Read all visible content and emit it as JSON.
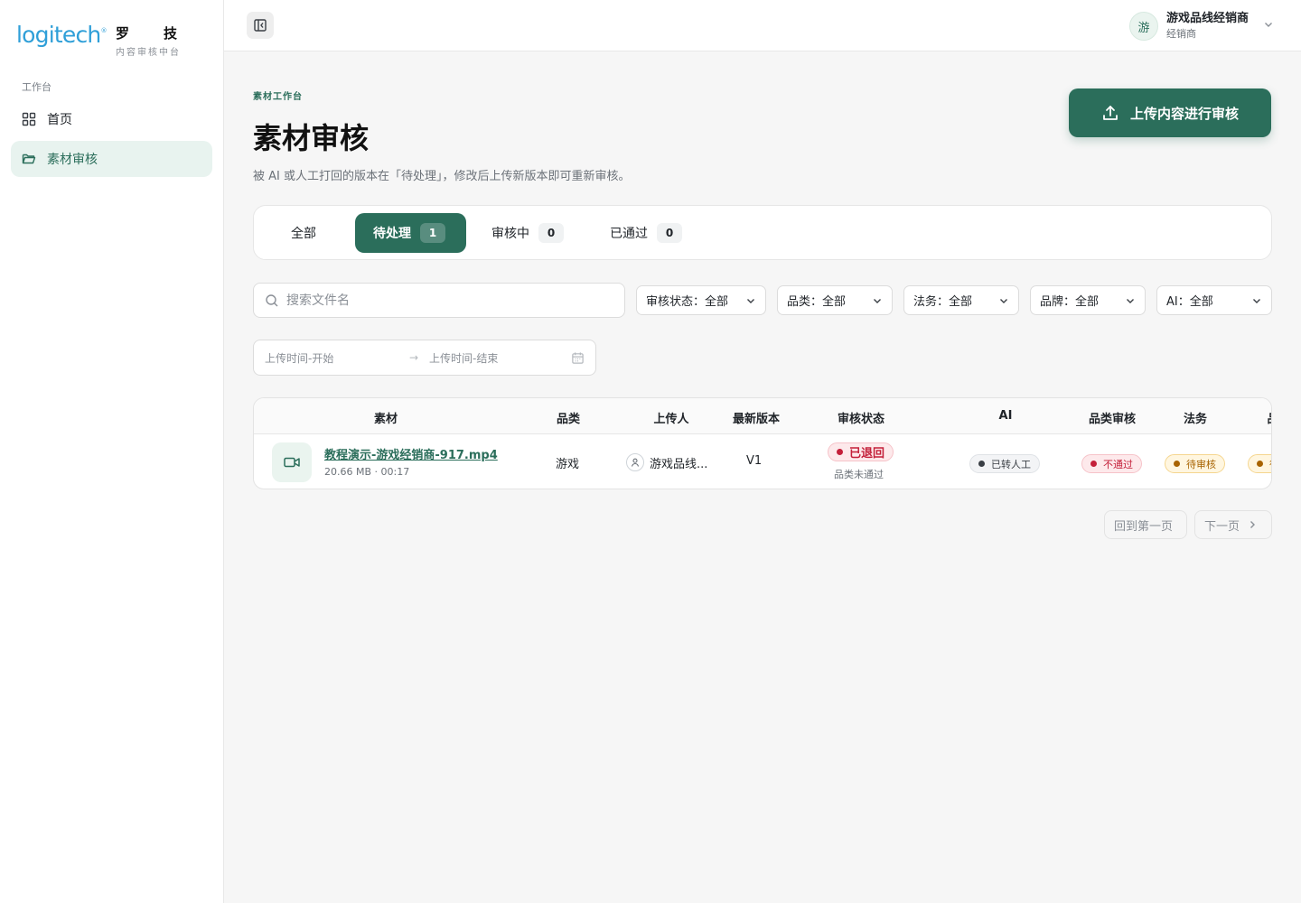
{
  "brand": {
    "logo": "logitech",
    "name_cn": "罗技",
    "subtitle": "内容审核中台"
  },
  "sidebar": {
    "section_label": "工作台",
    "items": [
      {
        "label": "首页",
        "icon": "grid-icon",
        "active": false
      },
      {
        "label": "素材审核",
        "icon": "folder-open-icon",
        "active": true
      }
    ]
  },
  "topbar": {
    "user": {
      "avatar_char": "游",
      "name": "游戏品线经销商",
      "role": "经销商"
    }
  },
  "header": {
    "breadcrumb": "素材工作台",
    "title": "素材审核",
    "description": "被 AI 或人工打回的版本在「待处理」，修改后上传新版本即可重新审核。",
    "upload_button": "上传内容进行审核"
  },
  "tabs": [
    {
      "label": "全部",
      "count": null
    },
    {
      "label": "待处理",
      "count": "1",
      "active": true
    },
    {
      "label": "审核中",
      "count": "0"
    },
    {
      "label": "已通过",
      "count": "0"
    }
  ],
  "filters": {
    "search_placeholder": "搜索文件名",
    "selects": [
      {
        "label": "审核状态：全部"
      },
      {
        "label": "品类：全部"
      },
      {
        "label": "法务：全部"
      },
      {
        "label": "品牌：全部"
      },
      {
        "label": "AI：全部"
      }
    ],
    "date_start_placeholder": "上传时间-开始",
    "date_end_placeholder": "上传时间-结束",
    "date_separator": "→"
  },
  "table": {
    "columns": [
      "素材",
      "品类",
      "上传人",
      "最新版本",
      "审核状态",
      "AI",
      "品类审核",
      "法务",
      "品"
    ],
    "rows": [
      {
        "file_name": "教程演示-游戏经销商-917.mp4",
        "file_meta": "20.66 MB · 00:17",
        "category": "游戏",
        "uploader": "游戏品线...",
        "version": "V1",
        "status": "已退回",
        "status_sub": "品类未通过",
        "ai": "已转人工",
        "category_review": "不通过",
        "legal": "待审核",
        "brand": "待"
      }
    ]
  },
  "pagination": {
    "first": "回到第一页",
    "next": "下一页"
  },
  "colors": {
    "accent": "#2b6e5b",
    "danger": "#c4203a",
    "warning": "#a86300",
    "neutral": "#3a3f45",
    "logo": "#2f9fd8"
  }
}
